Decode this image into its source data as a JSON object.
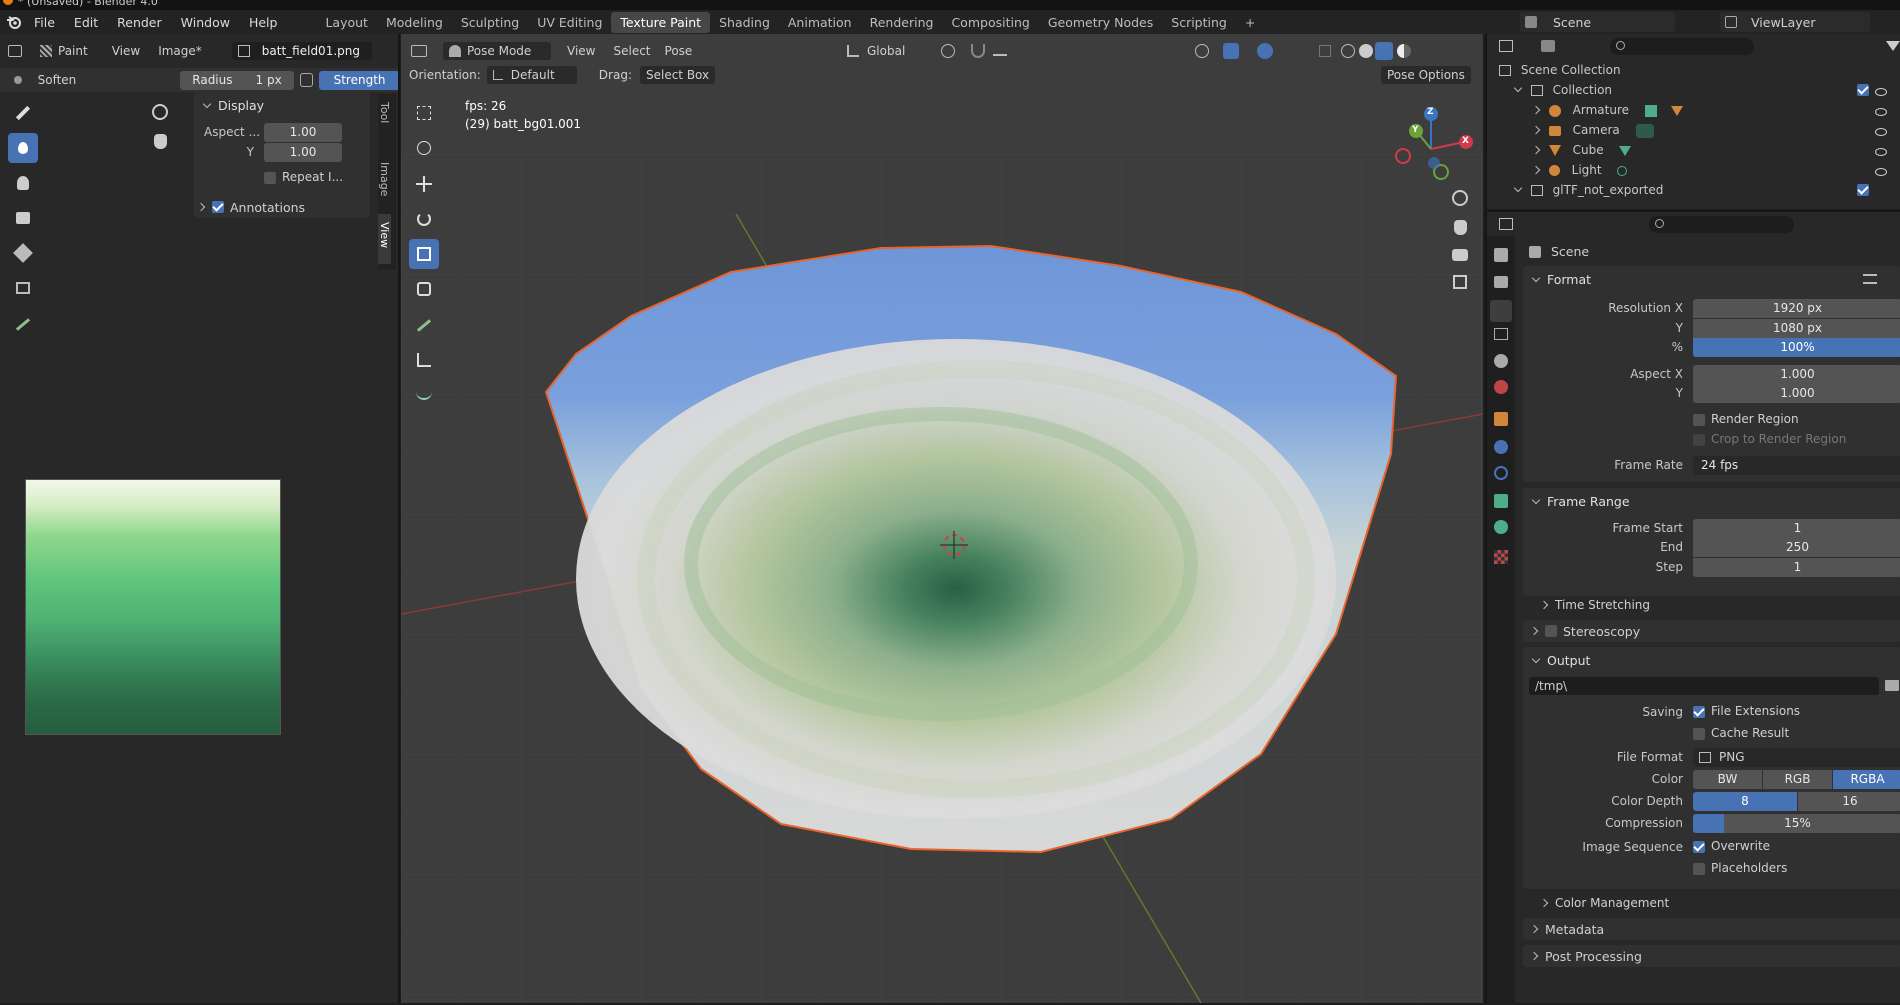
{
  "title_bar": {
    "title": "* (Unsaved) - Blender 4.0"
  },
  "menu": [
    "File",
    "Edit",
    "Render",
    "Window",
    "Help"
  ],
  "workspaces": [
    "Layout",
    "Modeling",
    "Sculpting",
    "UV Editing",
    "Texture Paint",
    "Shading",
    "Animation",
    "Rendering",
    "Compositing",
    "Geometry Nodes",
    "Scripting"
  ],
  "active_workspace": "Texture Paint",
  "topright": {
    "scene": "Scene",
    "view_layer": "ViewLayer"
  },
  "image_editor": {
    "mode": "Paint",
    "view": "View",
    "image_menu": "Image*",
    "image_name": "batt_field01.png",
    "brush": "Soften",
    "radius_label": "Radius",
    "radius_value": "1 px",
    "strength_label": "Strength",
    "panel_display": "Display",
    "aspect_label": "Aspect ...",
    "aspect_x": "1.00",
    "y_label": "Y",
    "aspect_y": "1.00",
    "repeat_label": "Repeat I...",
    "annotations": "Annotations",
    "tabs": [
      "Tool",
      "Image",
      "View"
    ]
  },
  "viewport": {
    "mode": "Pose Mode",
    "view": "View",
    "select": "Select",
    "pose": "Pose",
    "orientation_label": "Orientation:",
    "orientation": "Default",
    "drag_label": "Drag:",
    "drag": "Select Box",
    "transform": "Global",
    "pose_options": "Pose Options",
    "fps": "fps: 26",
    "object_info": "(29) batt_bg01.001",
    "gizmo": {
      "x": "X",
      "y": "Y",
      "z": "Z"
    }
  },
  "outliner": {
    "root": "Scene Collection",
    "items": [
      {
        "name": "Collection",
        "level": 1,
        "type": "collection"
      },
      {
        "name": "Armature",
        "level": 2,
        "type": "armature"
      },
      {
        "name": "Camera",
        "level": 2,
        "type": "camera"
      },
      {
        "name": "Cube",
        "level": 2,
        "type": "mesh"
      },
      {
        "name": "Light",
        "level": 2,
        "type": "light"
      },
      {
        "name": "glTF_not_exported",
        "level": 1,
        "type": "collection"
      }
    ]
  },
  "properties": {
    "context": "Scene",
    "format": {
      "header": "Format",
      "res_x_label": "Resolution X",
      "res_x": "1920 px",
      "res_y_label": "Y",
      "res_y": "1080 px",
      "pct_label": "%",
      "pct": "100%",
      "aspect_x_label": "Aspect X",
      "aspect_x": "1.000",
      "aspect_y_label": "Y",
      "aspect_y": "1.000",
      "render_region": "Render Region",
      "crop": "Crop to Render Region",
      "frame_rate_label": "Frame Rate",
      "frame_rate": "24 fps"
    },
    "frame_range": {
      "header": "Frame Range",
      "start_label": "Frame Start",
      "start": "1",
      "end_label": "End",
      "end": "250",
      "step_label": "Step",
      "step": "1",
      "time_stretching": "Time Stretching"
    },
    "stereoscopy": "Stereoscopy",
    "output": {
      "header": "Output",
      "path": "/tmp\\",
      "saving_label": "Saving",
      "file_extensions": "File Extensions",
      "cache_result": "Cache Result",
      "file_format_label": "File Format",
      "file_format": "PNG",
      "color_label": "Color",
      "color_options": [
        "BW",
        "RGB",
        "RGBA"
      ],
      "color_selected": "RGBA",
      "depth_label": "Color Depth",
      "depth_options": [
        "8",
        "16"
      ],
      "depth_selected": "8",
      "compression_label": "Compression",
      "compression": "15%",
      "compression_fraction": 0.15,
      "sequence_label": "Image Sequence",
      "overwrite": "Overwrite",
      "placeholders": "Placeholders",
      "color_management": "Color Management"
    },
    "metadata": "Metadata",
    "post_processing": "Post Processing"
  },
  "colors": {
    "accent": "#4772b3",
    "selection_outline": "#e8642d",
    "background": "#1d1d1d"
  }
}
